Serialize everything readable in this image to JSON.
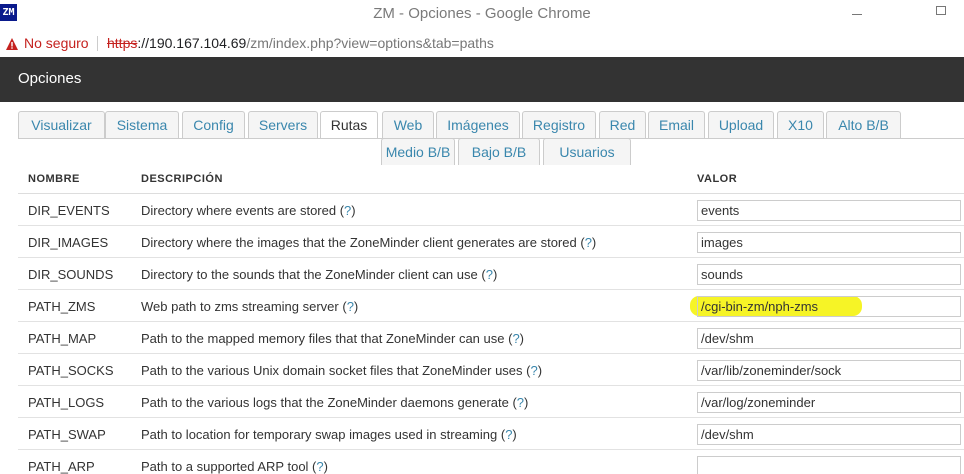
{
  "window": {
    "icon_text": "ZM",
    "title": "ZM - Opciones - Google Chrome"
  },
  "addressbar": {
    "security_label": "No seguro",
    "url_scheme": "https",
    "url_host": "://190.167.104.69",
    "url_path": "/zm/index.php?view=options&tab=paths"
  },
  "header": {
    "title": "Opciones"
  },
  "tabs": [
    {
      "label": "Visualizar"
    },
    {
      "label": "Sistema"
    },
    {
      "label": "Config"
    },
    {
      "label": "Servers"
    },
    {
      "label": "Rutas",
      "active": true
    },
    {
      "label": "Web"
    },
    {
      "label": "Imágenes"
    },
    {
      "label": "Registro"
    },
    {
      "label": "Red"
    },
    {
      "label": "Email"
    },
    {
      "label": "Upload"
    },
    {
      "label": "X10"
    },
    {
      "label": "Alto B/B"
    },
    {
      "label": "Medio B/B"
    },
    {
      "label": "Bajo B/B"
    },
    {
      "label": "Usuarios"
    }
  ],
  "table": {
    "headers": {
      "name": "NOMBRE",
      "description": "DESCRIPCIÓN",
      "value": "VALOR"
    },
    "help_text": "?",
    "rows": [
      {
        "name": "DIR_EVENTS",
        "description": "Directory where events are stored",
        "value": "events"
      },
      {
        "name": "DIR_IMAGES",
        "description": "Directory where the images that the ZoneMinder client generates are stored",
        "value": "images"
      },
      {
        "name": "DIR_SOUNDS",
        "description": "Directory to the sounds that the ZoneMinder client can use",
        "value": "sounds"
      },
      {
        "name": "PATH_ZMS",
        "description": "Web path to zms streaming server",
        "value": "/cgi-bin-zm/nph-zms"
      },
      {
        "name": "PATH_MAP",
        "description": "Path to the mapped memory files that that ZoneMinder can use",
        "value": "/dev/shm"
      },
      {
        "name": "PATH_SOCKS",
        "description": "Path to the various Unix domain socket files that ZoneMinder uses",
        "value": "/var/lib/zoneminder/sock"
      },
      {
        "name": "PATH_LOGS",
        "description": "Path to the various logs that the ZoneMinder daemons generate",
        "value": "/var/log/zoneminder"
      },
      {
        "name": "PATH_SWAP",
        "description": "Path to location for temporary swap images used in streaming",
        "value": "/dev/shm"
      },
      {
        "name": "PATH_ARP",
        "description": "Path to a supported ARP tool",
        "value": ""
      }
    ]
  },
  "colors": {
    "header_bg": "#333333",
    "link": "#3a87ad",
    "not_secure": "#c5221f",
    "highlight": "#f5f200"
  }
}
